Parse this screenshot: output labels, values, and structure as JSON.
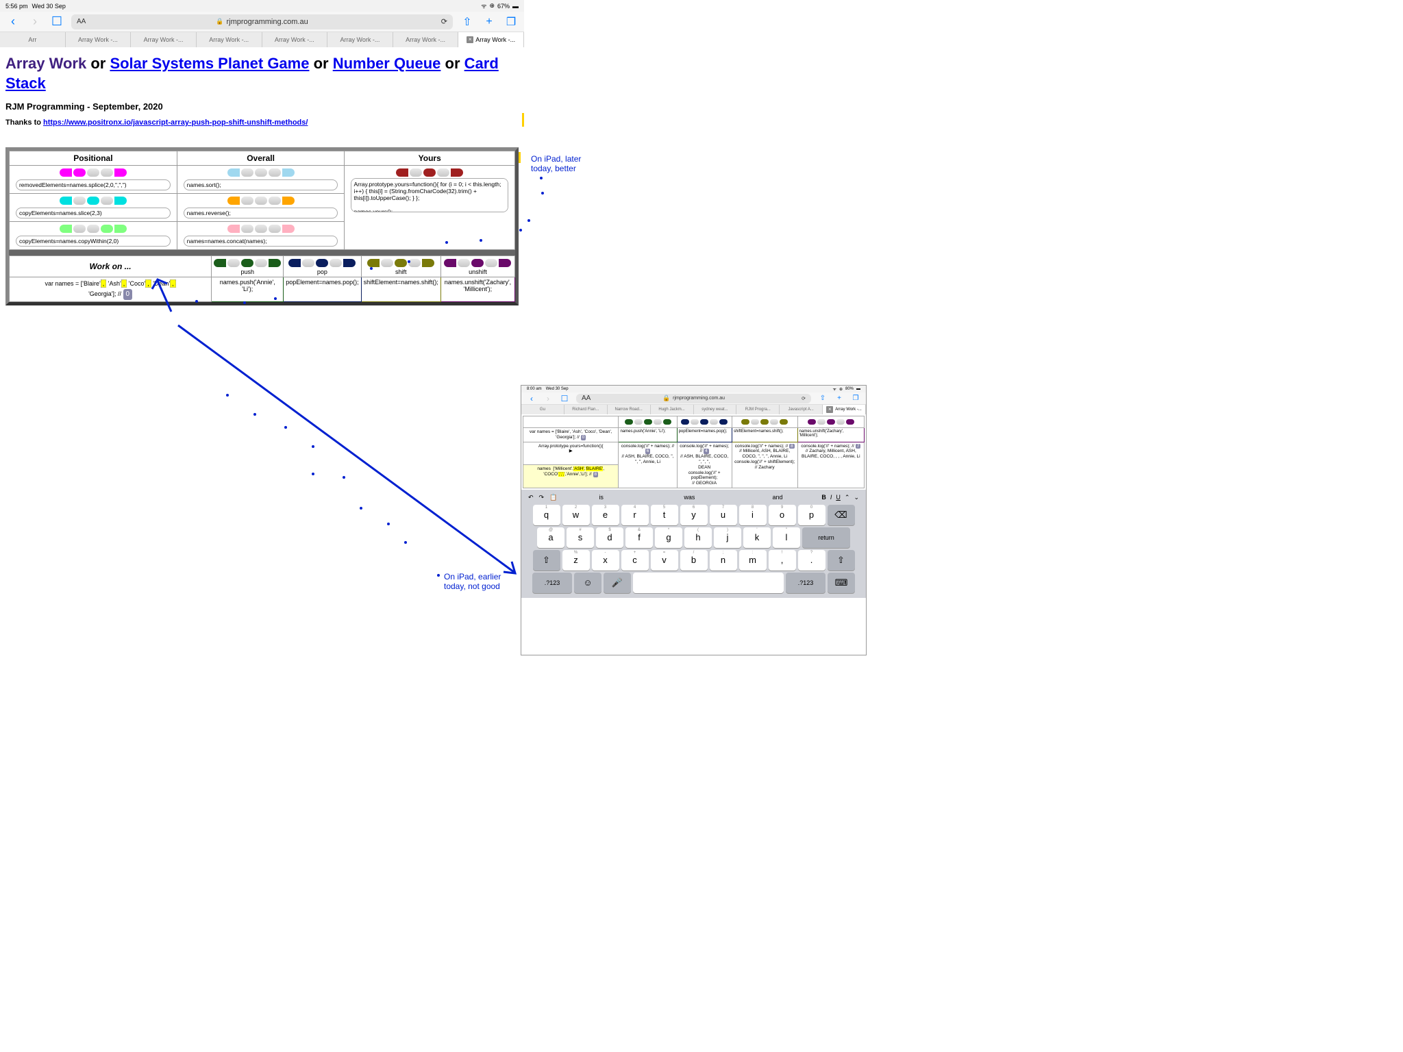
{
  "status1": {
    "time": "5:56 pm",
    "day": "Wed 30 Sep",
    "battery": "67%"
  },
  "status2": {
    "time": "8:00 am",
    "day": "Wed 30 Sep",
    "battery": "80%"
  },
  "url1": "rjmprogramming.com.au",
  "url2": "rjmprogramming.com.au",
  "tabs1": [
    "Arr",
    "Array Work -...",
    "Array Work -...",
    "Array Work -...",
    "Array Work -...",
    "Array Work -...",
    "Array Work -...",
    "Array Work -..."
  ],
  "tabs2": [
    "Gu",
    "Richard Flan...",
    "Narrow Road...",
    "Hugh Jackm...",
    "sydney weat...",
    "RJM Progra...",
    "Javascript A...",
    "Array Work -..."
  ],
  "h1": {
    "part1": "Array Work",
    "or1": " or ",
    "link1": "Solar Systems Planet Game",
    "or2": " or ",
    "link2": "Number Queue",
    "or3": " or ",
    "link3": "Card Stack"
  },
  "subtitle": "RJM Programming - September, 2020",
  "thanks_prefix": "Thanks to ",
  "thanks_link": "https://www.positronx.io/javascript-array-push-pop-shift-unshift-methods/",
  "cols": {
    "positional": "Positional",
    "overall": "Overall",
    "yours": "Yours"
  },
  "inputs": {
    "splice": "removedElements=names.splice(2,0,\",\",\")",
    "slice": "copyElements=names.slice(2,3)",
    "copywithin": "copyElements=names.copyWithin(2,0)",
    "sort": "names.sort();",
    "reverse": "names.reverse();",
    "concat": "names=names.concat(names);",
    "yours_code": "Array.prototype.yours=function(){ for (i = 0; i < this.length; i++) { this[i] = (String.fromCharCode(32).trim() + this[i]).toUpperCase(); } };\n\nnames.yours();"
  },
  "workon": "Work on ...",
  "methods": {
    "push": "push",
    "pop": "pop",
    "shift": "shift",
    "unshift": "unshift"
  },
  "method_codes": {
    "push": "names.push('Annie', 'Li');",
    "pop": "popElement=names.pop();",
    "shift": "shiftElement=names.shift();",
    "unshift": "names.unshift('Zachary', 'Millicent');"
  },
  "names_line1": "var names = ['Blaire', 'Ash', 'Coco', 'Dean',",
  "names_line2": "'Georgia']; //",
  "names_count": "0",
  "anno_later": "On iPad, later today, better",
  "anno_earlier": "On iPad, earlier today, not good",
  "second": {
    "names_line": "var names = ['Blaire', 'Ash', 'Coco', 'Dean', 'Georgia']; //",
    "names_badge": "0",
    "proto_line": "Array.prototype.yours=function(){",
    "arrow": "▶",
    "names_result": "names   ['Millicent','ASH','BLAIRE', 'COCO',',',',', 'Annie','Li']; //",
    "names_result_badge": "8",
    "push_code": "names.push('Annie', 'Li');",
    "pop_code": "popElement=names.pop();",
    "shift_code": "shiftElement=names.shift();",
    "unshift_code": "names.unshift('Zachary', 'Millicent');",
    "log1": {
      "pre": "console.log('//' + names); //",
      "b": "6",
      "body": "// ASH, BLAIRE, COCO, \", \", \", Annie, Li"
    },
    "log2": {
      "pre": "console.log('//' + names); //",
      "b": "4",
      "body": "// ASH, BLAIRE, COCO, \", \", \", \n DEAN\nconsole.log('//' + popElement);\n// GEORGIA"
    },
    "log3": {
      "pre": "console.log('//' + names); //",
      "b": "8",
      "body": "// Millicent, ASH, BLAIRE, COCO, \", \", \", Annie, Li\nconsole.log('//' + shiftElement);\n// Zachary"
    },
    "log4": {
      "pre": "console.log('//' + names); //",
      "b": "7",
      "body": "// Zachary, Millicent, ASH, BLAIRE, COCO, , , , Annie, Li"
    }
  },
  "kb": {
    "suggest": [
      "is",
      "was",
      "and"
    ],
    "fmt": [
      "B",
      "I",
      "U"
    ],
    "row1": [
      [
        "1",
        "q"
      ],
      [
        "2",
        "w"
      ],
      [
        "3",
        "e"
      ],
      [
        "4",
        "r"
      ],
      [
        "5",
        "t"
      ],
      [
        "6",
        "y"
      ],
      [
        "7",
        "u"
      ],
      [
        "8",
        "i"
      ],
      [
        "9",
        "o"
      ],
      [
        "0",
        "p"
      ]
    ],
    "row2": [
      [
        "@",
        "a"
      ],
      [
        "#",
        "s"
      ],
      [
        "$",
        "d"
      ],
      [
        "&",
        "f"
      ],
      [
        "*",
        "g"
      ],
      [
        "(",
        "h"
      ],
      [
        ")",
        "j"
      ],
      [
        "'",
        "k"
      ],
      [
        "\"",
        "l"
      ]
    ],
    "row3": [
      [
        "%",
        "z"
      ],
      [
        "-",
        "x"
      ],
      [
        "+",
        "c"
      ],
      [
        "=",
        "v"
      ],
      [
        "/",
        "b"
      ],
      [
        ";",
        "n"
      ],
      [
        ":",
        "m"
      ],
      [
        "!",
        ","
      ],
      [
        "?",
        "."
      ]
    ],
    "shift": "⇧",
    "back": "⌫",
    "return": "return",
    "num": ".?123",
    "emoji": "☺",
    "mic": "🎤",
    "kbd": "⌨"
  }
}
